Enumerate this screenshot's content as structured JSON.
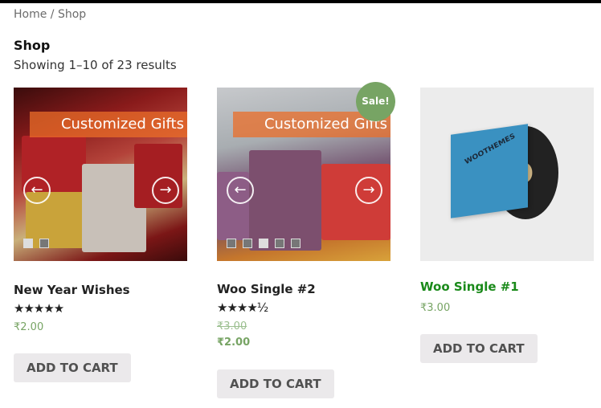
{
  "breadcrumb": {
    "home": "Home",
    "separator": " / ",
    "current": "Shop"
  },
  "page": {
    "title": "Shop",
    "result_count": "Showing 1–10 of 23 results"
  },
  "products": [
    {
      "name": "New Year Wishes",
      "rating_stars": "★★★★★",
      "rating": 5,
      "price": "₹2.00",
      "button": "ADD TO CART",
      "slider": {
        "caption": "Customized Gifts",
        "prev_glyph": "←",
        "next_glyph": "→",
        "dots": 2,
        "active_dot": 1
      }
    },
    {
      "name": "Woo Single #2",
      "rating_stars": "★★★★½",
      "rating": 4.5,
      "badge": "Sale!",
      "price_old": "₹3.00",
      "price": "₹2.00",
      "button": "ADD TO CART",
      "slider": {
        "caption": "Customized Gifts",
        "prev_glyph": "←",
        "next_glyph": "→",
        "dots": 5,
        "active_dot": 3
      }
    },
    {
      "name": "Woo Single #1",
      "price": "₹3.00",
      "button": "ADD TO CART",
      "image_text": "WOOTHEMES"
    }
  ],
  "colors": {
    "price_green": "#77a464",
    "sale_badge": "#77a464",
    "link_green": "#1a8a1a",
    "button_bg": "#ebe9eb"
  }
}
